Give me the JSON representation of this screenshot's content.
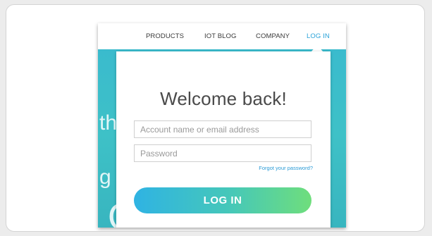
{
  "nav": {
    "items": [
      "PRODUCTS",
      "IOT BLOG",
      "COMPANY",
      "LOG IN"
    ]
  },
  "background_text": {
    "line1": "th",
    "line2": "g",
    "line3": "OS"
  },
  "login_popup": {
    "title": "Welcome back!",
    "account_placeholder": "Account name or email address",
    "password_placeholder": "Password",
    "forgot_link": "Forgot your password?",
    "submit_label": "LOG IN"
  },
  "colors": {
    "accent": "#2ba3d9",
    "background_teal": "#3ec1c7",
    "button_gradient_start": "#2fb3e3",
    "button_gradient_end": "#6fde7c"
  }
}
